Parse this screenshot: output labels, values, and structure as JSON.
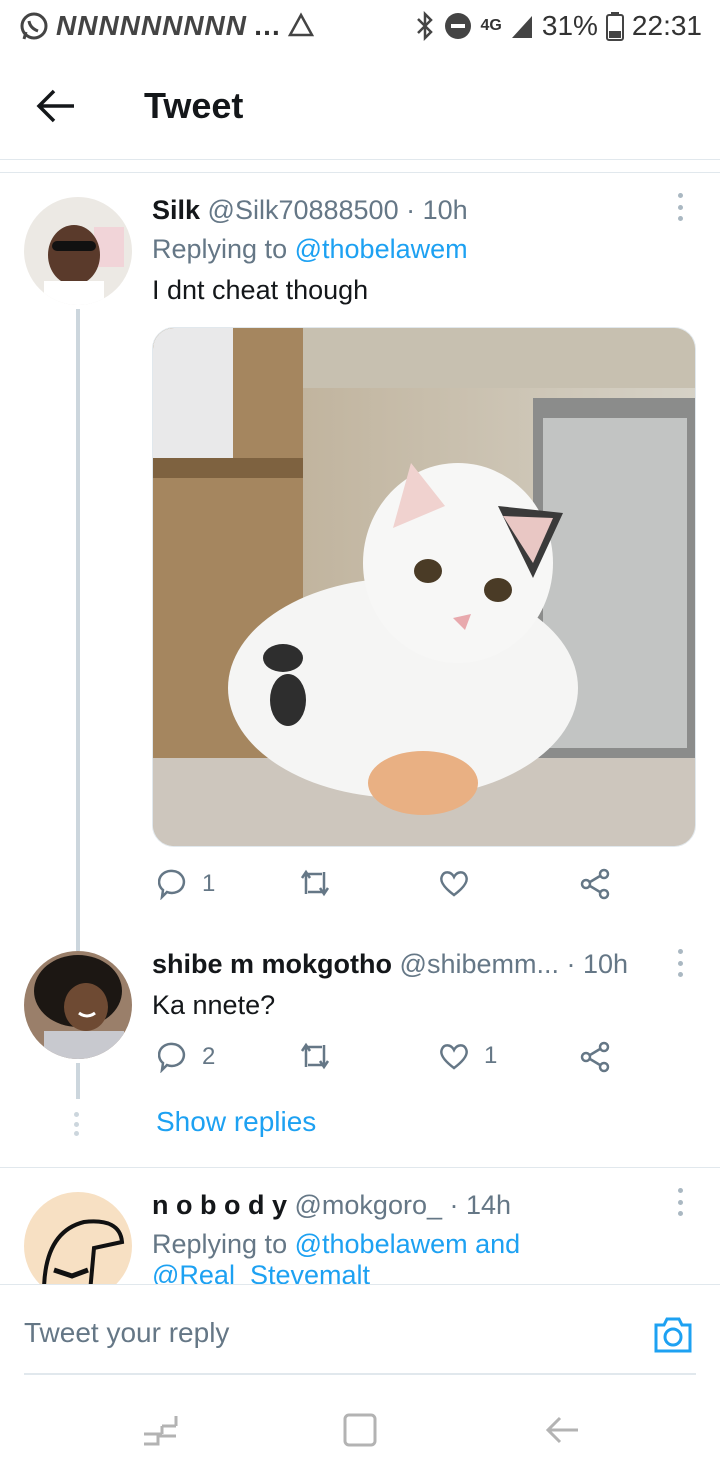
{
  "status_bar": {
    "notification_letters": "NNNNNNNNN",
    "overflow": "…",
    "network": "4G",
    "battery": "31%",
    "time": "22:31"
  },
  "header": {
    "title": "Tweet"
  },
  "tweets": [
    {
      "name": "Silk",
      "handle": "@Silk70888500",
      "time": "10h",
      "replying_label": "Replying to",
      "replying_to": "@thobelawem",
      "text": "I dnt cheat though",
      "reply_count": "1",
      "retweet_count": "",
      "like_count": ""
    },
    {
      "name": "shibe m mokgotho",
      "handle": "@shibemm...",
      "time": "10h",
      "text": "Ka nnete?",
      "reply_count": "2",
      "retweet_count": "",
      "like_count": "1",
      "show_replies": "Show replies"
    },
    {
      "name": "n o b o d y",
      "handle": "@mokgoro_",
      "time": "14h",
      "replying_label": "Replying to",
      "replying_to": "@thobelawem and",
      "replying_to_more": "@Real_Stevemalt"
    }
  ],
  "reply_bar": {
    "placeholder": "Tweet your reply"
  },
  "colors": {
    "link": "#1da1f2",
    "muted": "#657786",
    "text": "#14171a",
    "thread_line": "#ccd6dd"
  }
}
